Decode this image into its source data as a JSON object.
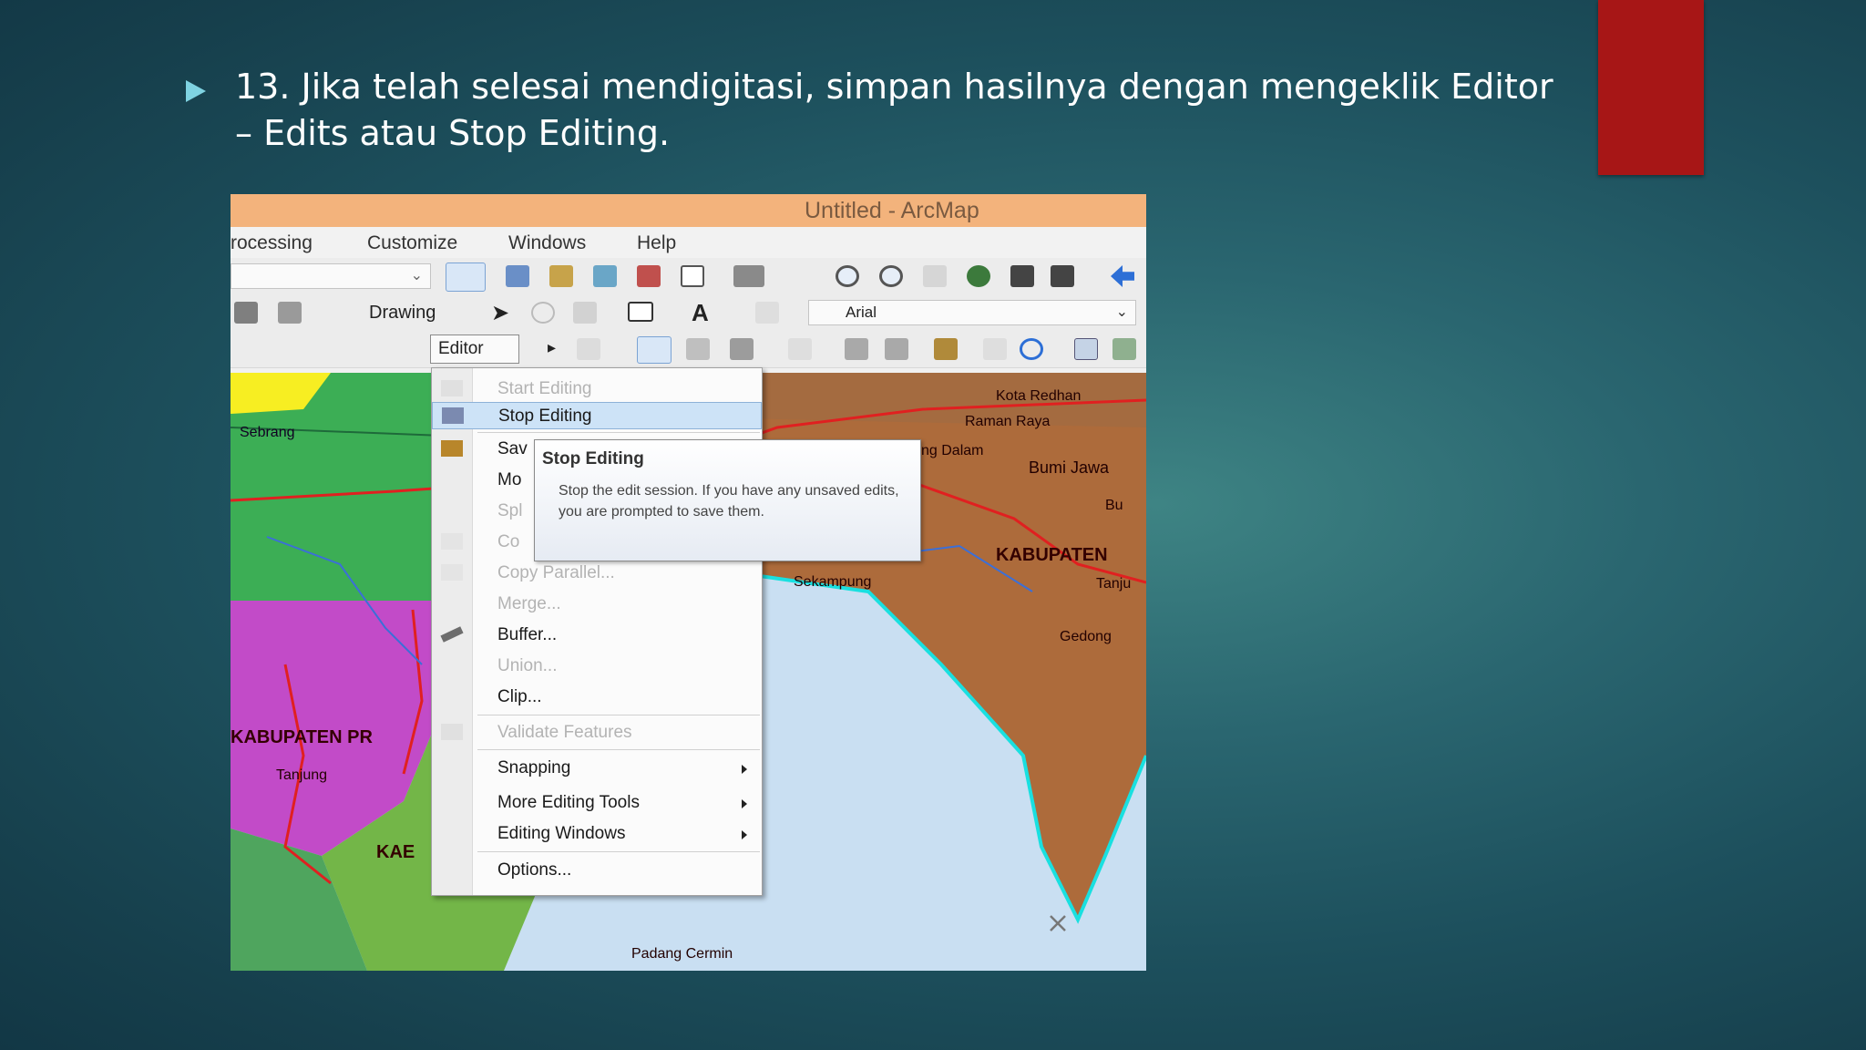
{
  "slide": {
    "caption_line1": "13. Jika telah selesai mendigitasi, simpan hasilnya dengan mengeklik Editor",
    "caption_line2": "– Edits atau Stop Editing.",
    "accent_color": "#a71616",
    "bullet_icon": "triangle-bullet-icon"
  },
  "window": {
    "title": "Untitled - ArcMap",
    "menus": [
      "rocessing",
      "Customize",
      "Windows",
      "Help"
    ],
    "drawing_label": "Drawing",
    "font_combo_value": "Arial",
    "editor_label": "Editor"
  },
  "editor_menu": {
    "items": [
      {
        "label": "Start Editing",
        "disabled": true
      },
      {
        "label": "Stop Editing",
        "highlighted": true
      },
      {
        "label": "Sav"
      },
      {
        "label": "Mo"
      },
      {
        "label": "Spl",
        "disabled": true
      },
      {
        "label": "Co",
        "disabled": true
      },
      {
        "label": "Copy Parallel...",
        "disabled": true
      },
      {
        "label": "Merge...",
        "disabled": true
      },
      {
        "label": "Buffer..."
      },
      {
        "label": "Union...",
        "disabled": true
      },
      {
        "label": "Clip..."
      },
      {
        "label": "Validate Features",
        "disabled": true
      },
      {
        "label": "Snapping",
        "submenu": true
      },
      {
        "label": "More Editing Tools",
        "submenu": true
      },
      {
        "label": "Editing Windows",
        "submenu": true
      },
      {
        "label": "Options..."
      }
    ]
  },
  "tooltip": {
    "title": "Stop Editing",
    "text": "Stop the edit session. If you have any unsaved edits, you are prompted to save them."
  },
  "map_labels": {
    "l1": "Kota Redhan",
    "l2": "Raman Raya",
    "l3": "ng Dalam",
    "l4": "Bumi Jawa",
    "l5": "KABUPATEN",
    "l6": "Sekampung",
    "l7": "Tanju",
    "l8": "Gedong",
    "l9": "Sebrang",
    "l10": "KABUPATEN PR",
    "l11": "Tanjung",
    "l12": "KAE",
    "l13": "Padang Cermin",
    "l14": "Bu"
  }
}
